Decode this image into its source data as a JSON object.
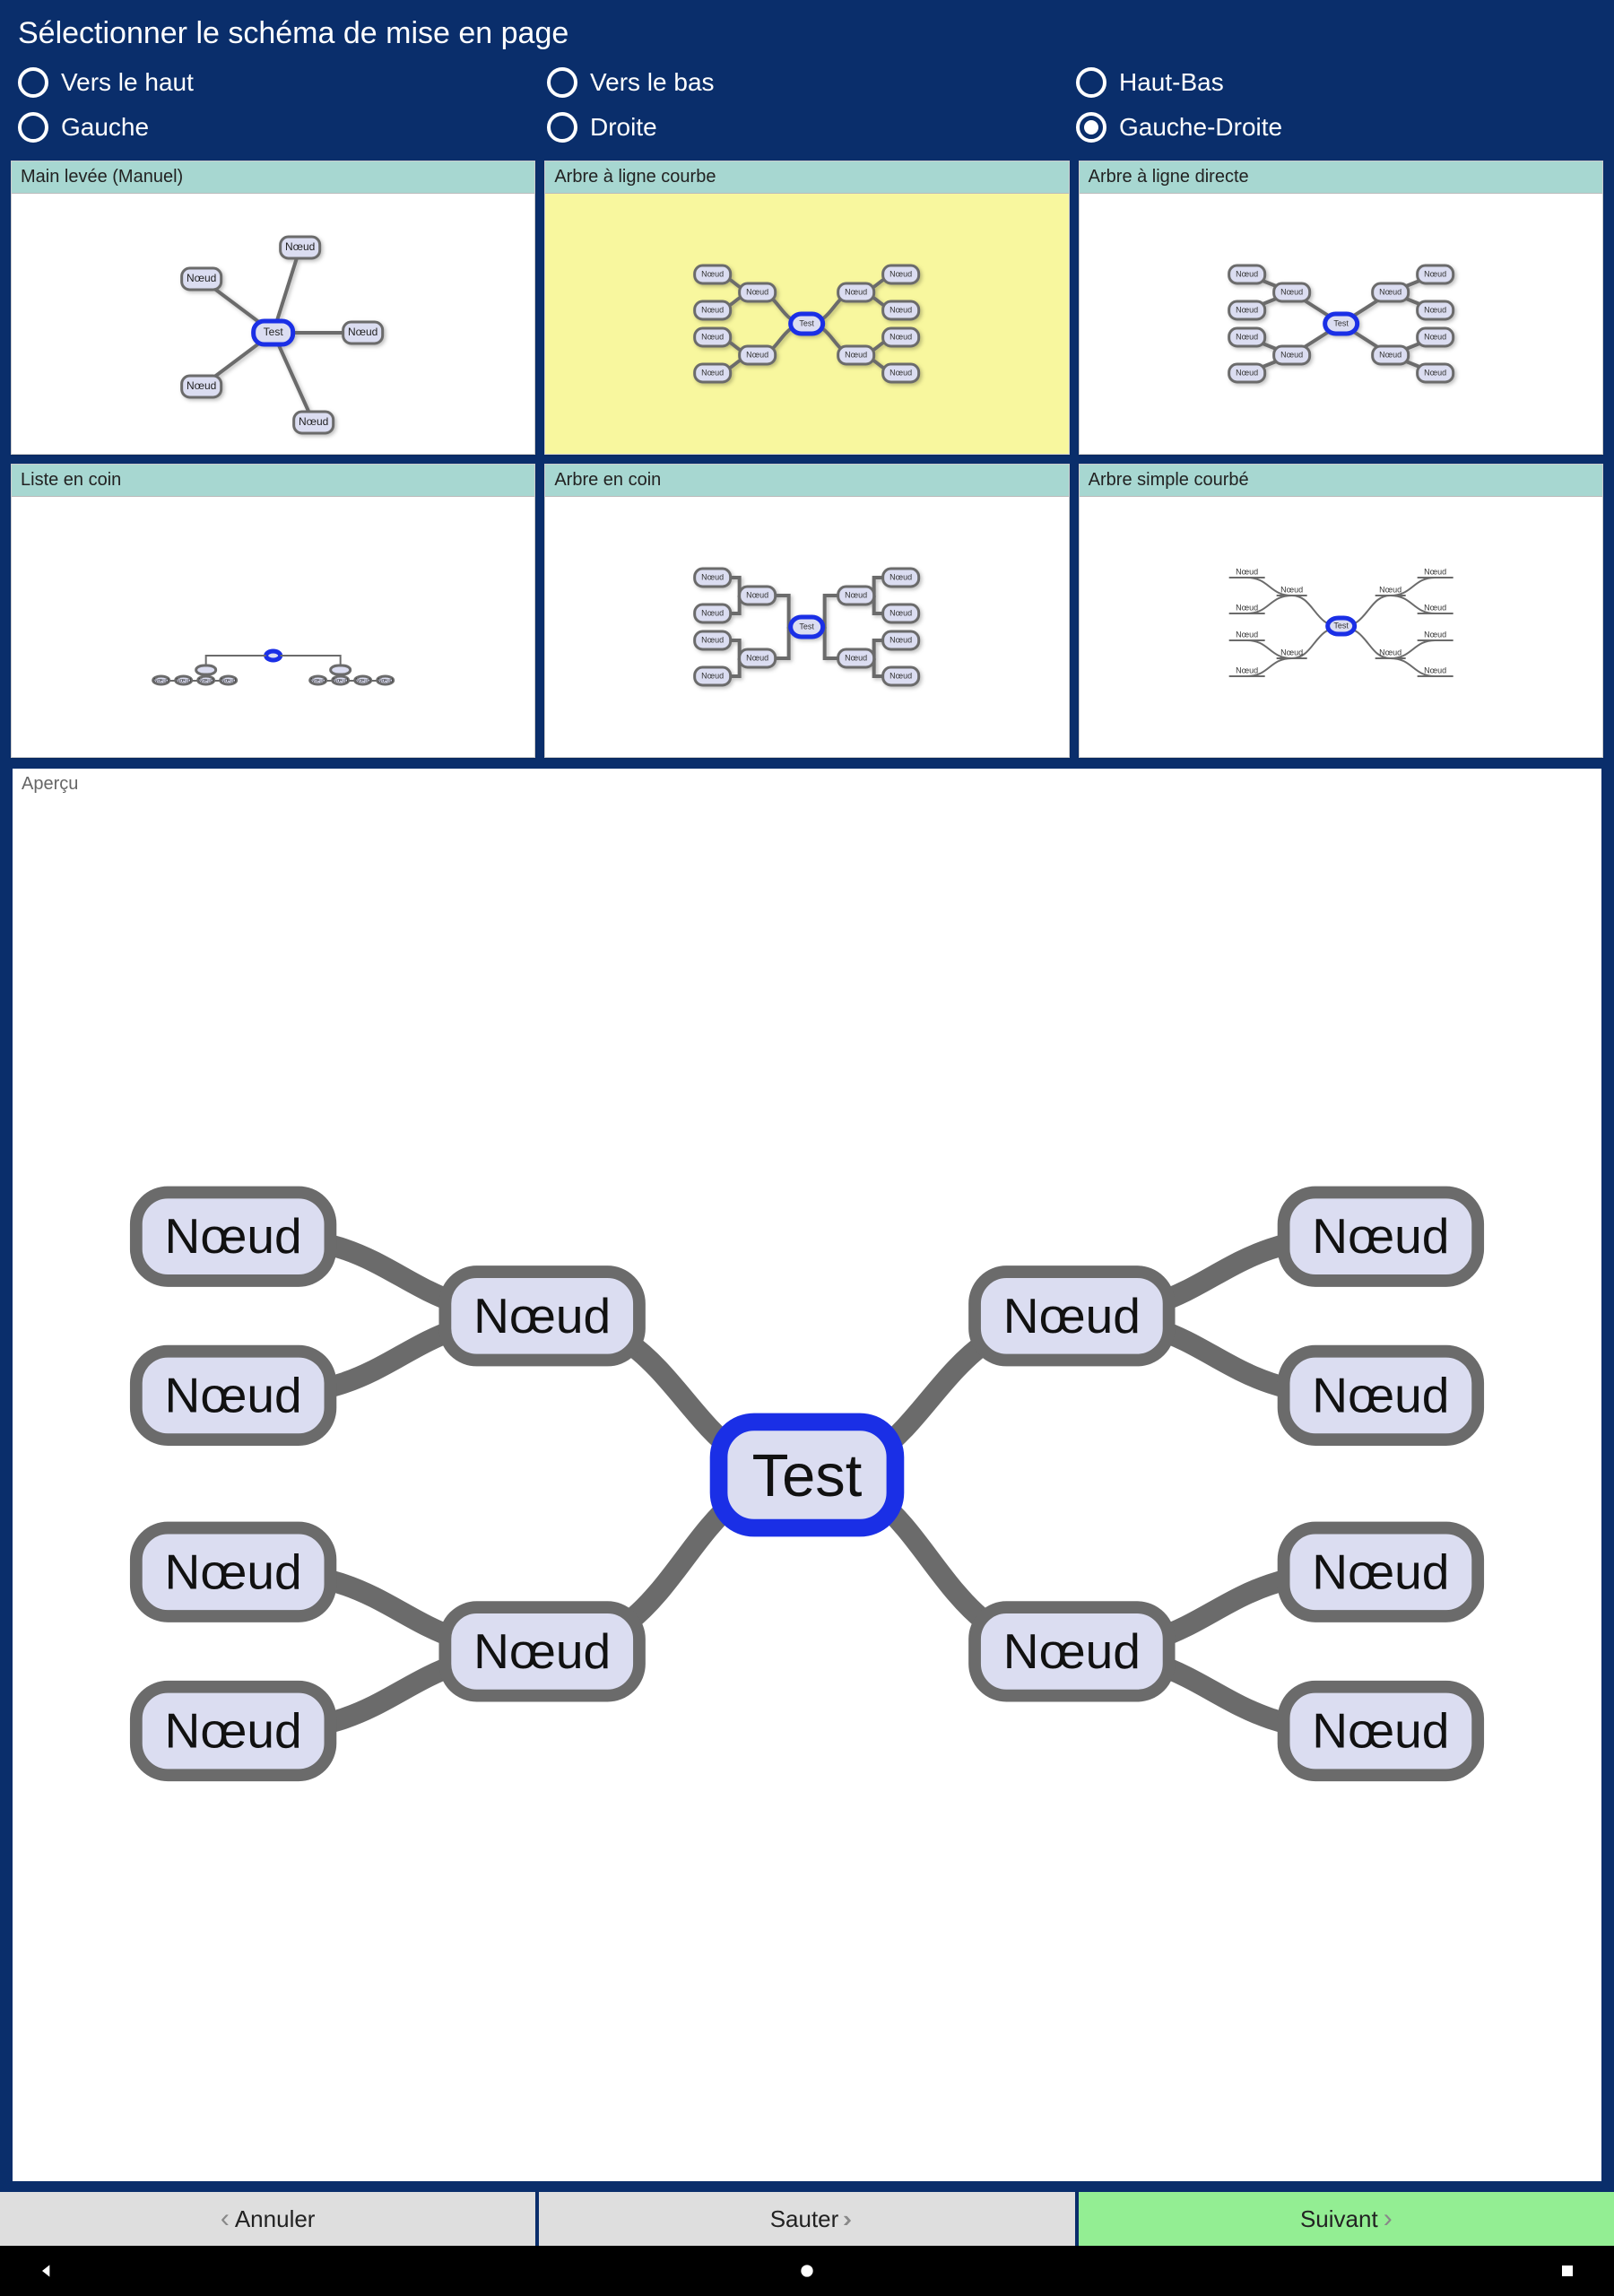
{
  "header": {
    "title": "Sélectionner le schéma de mise en page",
    "radios": [
      {
        "id": "vers-le-haut",
        "label": "Vers le haut",
        "selected": false
      },
      {
        "id": "vers-le-bas",
        "label": "Vers le bas",
        "selected": false
      },
      {
        "id": "haut-bas",
        "label": "Haut-Bas",
        "selected": false
      },
      {
        "id": "gauche",
        "label": "Gauche",
        "selected": false
      },
      {
        "id": "droite",
        "label": "Droite",
        "selected": false
      },
      {
        "id": "gauche-droite",
        "label": "Gauche-Droite",
        "selected": true
      }
    ]
  },
  "layouts": [
    {
      "id": "freehand",
      "label": "Main levée (Manuel)",
      "selected": false
    },
    {
      "id": "curved-tree",
      "label": "Arbre à ligne courbe",
      "selected": true
    },
    {
      "id": "direct-tree",
      "label": "Arbre à ligne directe",
      "selected": false
    },
    {
      "id": "corner-list",
      "label": "Liste en coin",
      "selected": false
    },
    {
      "id": "corner-tree",
      "label": "Arbre en coin",
      "selected": false
    },
    {
      "id": "simple-curved",
      "label": "Arbre simple courbé",
      "selected": false
    }
  ],
  "node_labels": {
    "root": "Test",
    "child": "Nœud"
  },
  "preview": {
    "label": "Aperçu"
  },
  "actions": {
    "cancel": "Annuler",
    "skip": "Sauter",
    "next": "Suivant"
  }
}
